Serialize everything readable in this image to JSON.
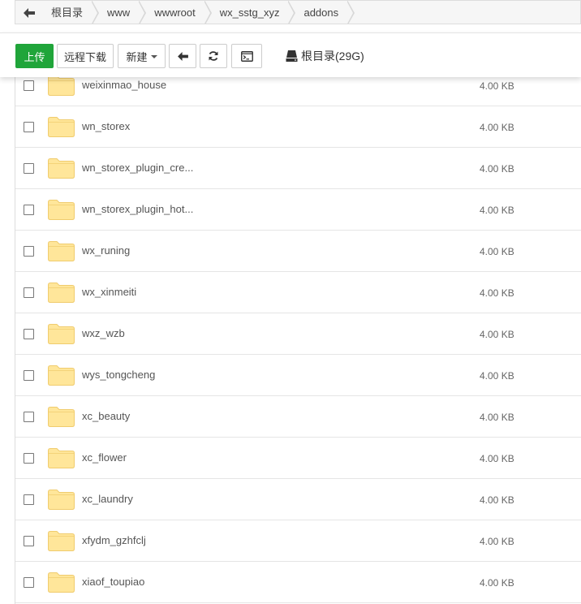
{
  "breadcrumb": {
    "back_icon": "arrow-left-icon",
    "items": [
      "根目录",
      "www",
      "wwwroot",
      "wx_sstg_xyz",
      "addons"
    ]
  },
  "toolbar": {
    "upload_label": "上传",
    "remote_download_label": "远程下载",
    "new_label": "新建",
    "back_icon": "arrow-left-icon",
    "refresh_icon": "refresh-icon",
    "terminal_icon": "terminal-icon",
    "disk_icon": "hard-drive-icon",
    "disk_label": "根目录(29G)"
  },
  "colors": {
    "primary": "#20a53a",
    "folder": "#ffe69a",
    "folder_border": "#f0cc6e"
  },
  "files": [
    {
      "name": "weixinmao_house",
      "size": "4.00 KB"
    },
    {
      "name": "wn_storex",
      "size": "4.00 KB"
    },
    {
      "name": "wn_storex_plugin_cre...",
      "size": "4.00 KB"
    },
    {
      "name": "wn_storex_plugin_hot...",
      "size": "4.00 KB"
    },
    {
      "name": "wx_runing",
      "size": "4.00 KB"
    },
    {
      "name": "wx_xinmeiti",
      "size": "4.00 KB"
    },
    {
      "name": "wxz_wzb",
      "size": "4.00 KB"
    },
    {
      "name": "wys_tongcheng",
      "size": "4.00 KB"
    },
    {
      "name": "xc_beauty",
      "size": "4.00 KB"
    },
    {
      "name": "xc_flower",
      "size": "4.00 KB"
    },
    {
      "name": "xc_laundry",
      "size": "4.00 KB"
    },
    {
      "name": "xfydm_gzhfclj",
      "size": "4.00 KB"
    },
    {
      "name": "xiaof_toupiao",
      "size": "4.00 KB"
    }
  ]
}
